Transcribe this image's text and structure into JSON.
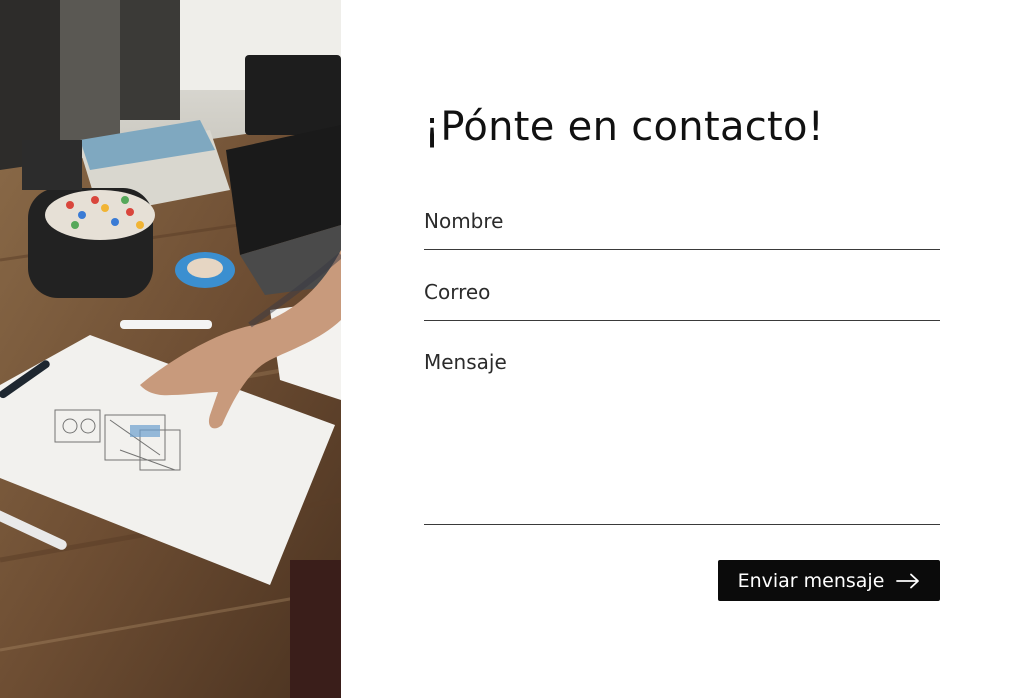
{
  "form": {
    "heading": "¡Pónte en contacto!",
    "name_placeholder": "Nombre",
    "email_placeholder": "Correo",
    "message_placeholder": "Mensaje",
    "submit_label": "Enviar mensaje",
    "submit_icon": "arrow-right-icon"
  },
  "photo": {
    "subject": "workspace-desk-photo"
  },
  "colors": {
    "background": "#ffffff",
    "text": "#111111",
    "button_bg": "#0b0b0b",
    "button_text": "#ffffff",
    "divider": "#3a3a3a"
  }
}
